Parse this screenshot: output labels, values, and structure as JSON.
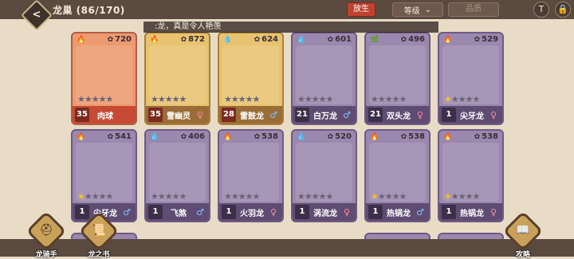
{
  "header": {
    "back_icon": "back-arrow-icon",
    "title": "龙巢 (86/170)",
    "release_label": "放生",
    "sort_label": "等级",
    "sort_chevron": "⌄",
    "quality_placeholder": "品质",
    "filter_icon": "T",
    "lock_icon": "🔒"
  },
  "toast_text": ":龙，真是令人艳羡",
  "cards": [
    {
      "element": "🔥",
      "power": "720",
      "level": "35",
      "name": "肉球",
      "gender": "",
      "stars_on": 0,
      "stars_total": 5,
      "theme": "orange"
    },
    {
      "element": "🔥",
      "power": "872",
      "level": "35",
      "name": "雪幽灵",
      "gender": "♀",
      "stars_on": 0,
      "stars_total": 5,
      "theme": "gold"
    },
    {
      "element": "💧",
      "power": "624",
      "level": "28",
      "name": "雷鼓龙",
      "gender": "♂",
      "stars_on": 0,
      "stars_total": 5,
      "theme": "gold"
    },
    {
      "element": "💧",
      "power": "601",
      "level": "21",
      "name": "白万龙",
      "gender": "♂",
      "stars_on": 0,
      "stars_total": 5,
      "theme": "purple"
    },
    {
      "element": "🌿",
      "power": "496",
      "level": "21",
      "name": "双头龙",
      "gender": "♀",
      "stars_on": 0,
      "stars_total": 5,
      "theme": "purple"
    },
    {
      "element": "🔥",
      "power": "529",
      "level": "1",
      "name": "尖牙龙",
      "gender": "♀",
      "stars_on": 1,
      "stars_total": 5,
      "theme": "purple"
    },
    {
      "element": "🔥",
      "power": "541",
      "level": "1",
      "name": "尖牙龙",
      "gender": "♂",
      "stars_on": 1,
      "stars_total": 5,
      "theme": "purple"
    },
    {
      "element": "💧",
      "power": "406",
      "level": "1",
      "name": "飞煞",
      "gender": "♂",
      "stars_on": 0,
      "stars_total": 5,
      "theme": "purple"
    },
    {
      "element": "🔥",
      "power": "538",
      "level": "1",
      "name": "火羽龙",
      "gender": "♀",
      "stars_on": 0,
      "stars_total": 5,
      "theme": "purple"
    },
    {
      "element": "💧",
      "power": "520",
      "level": "1",
      "name": "涡流龙",
      "gender": "♀",
      "stars_on": 0,
      "stars_total": 5,
      "theme": "purple"
    },
    {
      "element": "🔥",
      "power": "538",
      "level": "1",
      "name": "热锅龙",
      "gender": "♂",
      "stars_on": 1,
      "stars_total": 5,
      "theme": "purple"
    },
    {
      "element": "🔥",
      "power": "538",
      "level": "1",
      "name": "热锅龙",
      "gender": "♀",
      "stars_on": 1,
      "stars_total": 5,
      "theme": "purple"
    }
  ],
  "bottom_nav": [
    {
      "label": "龙骑手",
      "icon": "viking-helmet-icon"
    },
    {
      "label": "龙之书",
      "icon": "book-icon"
    },
    {
      "label": "攻略",
      "icon": "guide-book-icon"
    }
  ]
}
